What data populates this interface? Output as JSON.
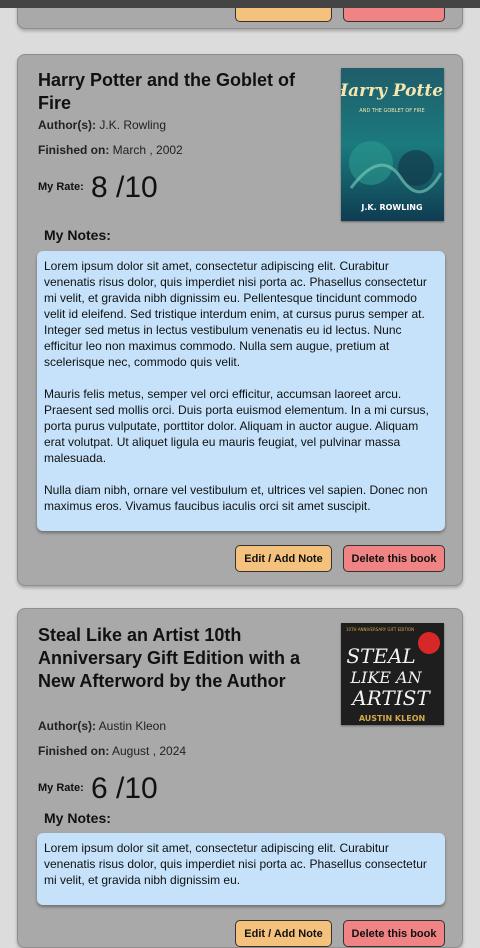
{
  "books": [
    {
      "title": "Harry Potter and the Goblet of Fire",
      "author_label": "Author(s):",
      "author": "J.K. Rowling",
      "finished_label": "Finished on:",
      "finished": "March , 2002",
      "rate_label": "My Rate:",
      "rate": "8 /10",
      "notes_label": "My Notes:",
      "cover_text": {
        "title": "Harry Potter",
        "subtitle": "AND THE GOBLET OF FIRE",
        "author": "J.K. ROWLING"
      },
      "notes": [
        "Lorem ipsum dolor sit amet, consectetur adipiscing elit. Curabitur venenatis risus dolor, quis imperdiet nisi porta ac. Phasellus consectetur mi velit, et gravida nibh dignissim eu. Pellentesque tincidunt commodo velit id eleifend. Sed tristique interdum enim, at cursus purus semper at. Integer sed metus in lectus vestibulum venenatis eu id lectus. Nunc efficitur leo non maximus commodo. Nulla sem augue, pretium at scelerisque nec, commodo quis velit.",
        "Mauris felis metus, semper vel orci efficitur, accumsan laoreet arcu. Praesent sed mollis orci. Duis porta euismod elementum. In a mi cursus, porta purus vulputate, porttitor dolor. Aliquam in auctor augue. Aliquam erat volutpat. Ut aliquet ligula eu mauris feugiat, vel pulvinar massa malesuada.",
        "Nulla diam nibh, ornare vel vestibulum et, ultrices vel sapien. Donec non maximus eros. Vivamus faucibus iaculis orci sit amet suscipit."
      ],
      "edit_label": "Edit / Add Note",
      "delete_label": "Delete this book"
    },
    {
      "title": "Steal Like an Artist 10th Anniversary Gift Edition with a New Afterword by the Author",
      "author_label": "Author(s):",
      "author": "Austin Kleon",
      "finished_label": "Finished on:",
      "finished": "August , 2024",
      "rate_label": "My Rate:",
      "rate": "6 /10",
      "notes_label": "My Notes:",
      "cover_text": {
        "top": "10TH ANNIVERSARY GIFT EDITION",
        "l1": "STEAL",
        "l2": "LIKE AN",
        "l3": "ARTIST",
        "author": "AUSTIN KLEON"
      },
      "notes": [
        "Lorem ipsum dolor sit amet, consectetur adipiscing elit. Curabitur venenatis risus dolor, quis imperdiet nisi porta ac. Phasellus consectetur mi velit, et gravida nibh dignissim eu."
      ],
      "edit_label": "Edit / Add Note",
      "delete_label": "Delete this book"
    }
  ],
  "colors": {
    "card": "#a9a9a9",
    "notes": "#c5e2fa",
    "edit": "#f4c27d",
    "delete": "#f08484"
  }
}
